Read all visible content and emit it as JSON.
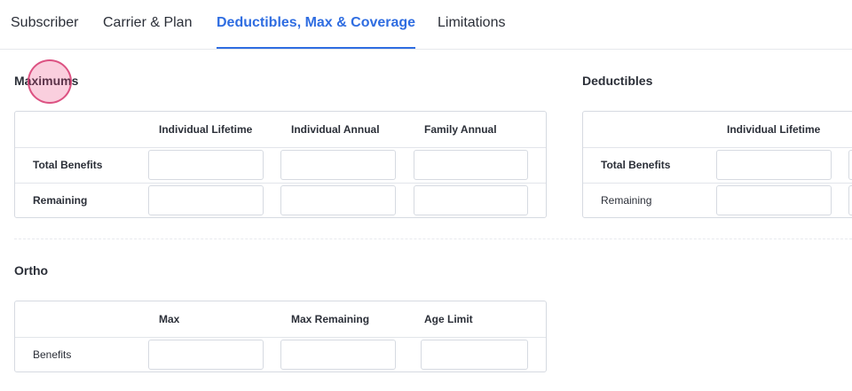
{
  "tabs": [
    {
      "label": "Subscriber",
      "active": false
    },
    {
      "label": "Carrier & Plan",
      "active": false
    },
    {
      "label": "Deductibles, Max & Coverage",
      "active": true
    },
    {
      "label": "Limitations",
      "active": false
    }
  ],
  "maximums": {
    "title": "Maximums",
    "columns": [
      "Individual Lifetime",
      "Individual Annual",
      "Family Annual"
    ],
    "rows": [
      {
        "label": "Total Benefits",
        "values": [
          "",
          "",
          ""
        ]
      },
      {
        "label": "Remaining",
        "values": [
          "",
          "",
          ""
        ]
      }
    ]
  },
  "deductibles": {
    "title": "Deductibles",
    "columns": [
      "Individual Lifetime"
    ],
    "rows": [
      {
        "label": "Total Benefits",
        "values": [
          ""
        ]
      },
      {
        "label": "Remaining",
        "values": [
          ""
        ]
      }
    ]
  },
  "ortho": {
    "title": "Ortho",
    "columns": [
      "Max",
      "Max Remaining",
      "Age Limit"
    ],
    "rows": [
      {
        "label": "Benefits",
        "values": [
          "",
          "",
          ""
        ]
      }
    ]
  },
  "colors": {
    "accent": "#2f6de1",
    "border": "#d6dae1",
    "cursor_highlight": "#ec407a"
  }
}
